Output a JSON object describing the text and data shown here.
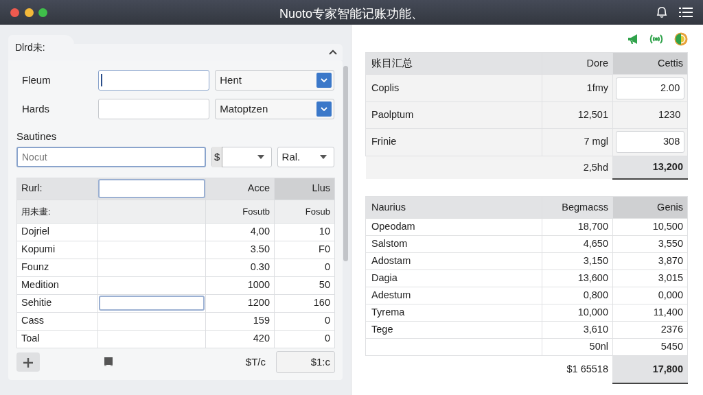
{
  "window": {
    "title": "Nuoto专家智能记账功能、"
  },
  "form": {
    "tab": "Dlrd未:",
    "expanded": true,
    "fields": [
      {
        "label": "Fleum",
        "option": "Hent",
        "focused": true
      },
      {
        "label": "Hards",
        "option": "Matoptzen",
        "focused": false
      }
    ],
    "section": "Sautines",
    "search": {
      "placeholder": "Nocut"
    },
    "currency": "$",
    "rate": "Ral."
  },
  "entries": {
    "header": {
      "label": "Rurl:",
      "columns": [
        "Acce",
        "Llus"
      ]
    },
    "subheader": {
      "label": "用未畫:",
      "columns": [
        "Fosutb",
        "Fosub"
      ]
    },
    "rows": [
      {
        "label": "Dojriel",
        "values": [
          "4,00",
          "10"
        ],
        "editing": false
      },
      {
        "label": "Kopumi",
        "values": [
          "3.50",
          "F0"
        ],
        "editing": false
      },
      {
        "label": "Founz",
        "values": [
          "0.30",
          "0"
        ],
        "editing": false
      },
      {
        "label": "Medition",
        "values": [
          "1000",
          "50"
        ],
        "editing": false
      },
      {
        "label": "Sehitie",
        "values": [
          "1200",
          "160"
        ],
        "editing": true
      },
      {
        "label": "Cass",
        "values": [
          "159",
          "0"
        ],
        "editing": false
      },
      {
        "label": "Toal",
        "values": [
          "420",
          "0"
        ],
        "editing": false
      }
    ],
    "footer": {
      "total_label": "$T/c",
      "total_value": "$1:c"
    }
  },
  "summary": {
    "columns": [
      "账目汇总",
      "Dore",
      "Cettis"
    ],
    "rows": [
      {
        "label": "Coplis",
        "values": [
          "1fmy",
          "2.00"
        ],
        "boxed": true
      },
      {
        "label": "Paolptum",
        "values": [
          "12,501",
          "1230"
        ],
        "boxed": false
      },
      {
        "label": "Frinie",
        "values": [
          "7 mgl",
          "308"
        ],
        "boxed": true
      }
    ],
    "total": [
      "2,5hd",
      "13,200"
    ]
  },
  "breakdown": {
    "columns": [
      "Naurius",
      "Begmacss",
      "Genis"
    ],
    "rows": [
      {
        "label": "Opeodam",
        "values": [
          "18,700",
          "10,500"
        ]
      },
      {
        "label": "Salstom",
        "values": [
          "4,650",
          "3,550"
        ]
      },
      {
        "label": "Adostam",
        "values": [
          "3,150",
          "3,870"
        ]
      },
      {
        "label": "Dagia",
        "values": [
          "13,600",
          "3,015"
        ]
      },
      {
        "label": "Adestum",
        "values": [
          "0,800",
          "0,000"
        ]
      },
      {
        "label": "Tyrema",
        "values": [
          "10,000",
          "11,400"
        ]
      },
      {
        "label": "Tege",
        "values": [
          "3,610",
          "2376"
        ]
      },
      {
        "values": [
          "50nl",
          "5450"
        ]
      }
    ],
    "total": [
      "$1 65518",
      "17,800"
    ]
  }
}
